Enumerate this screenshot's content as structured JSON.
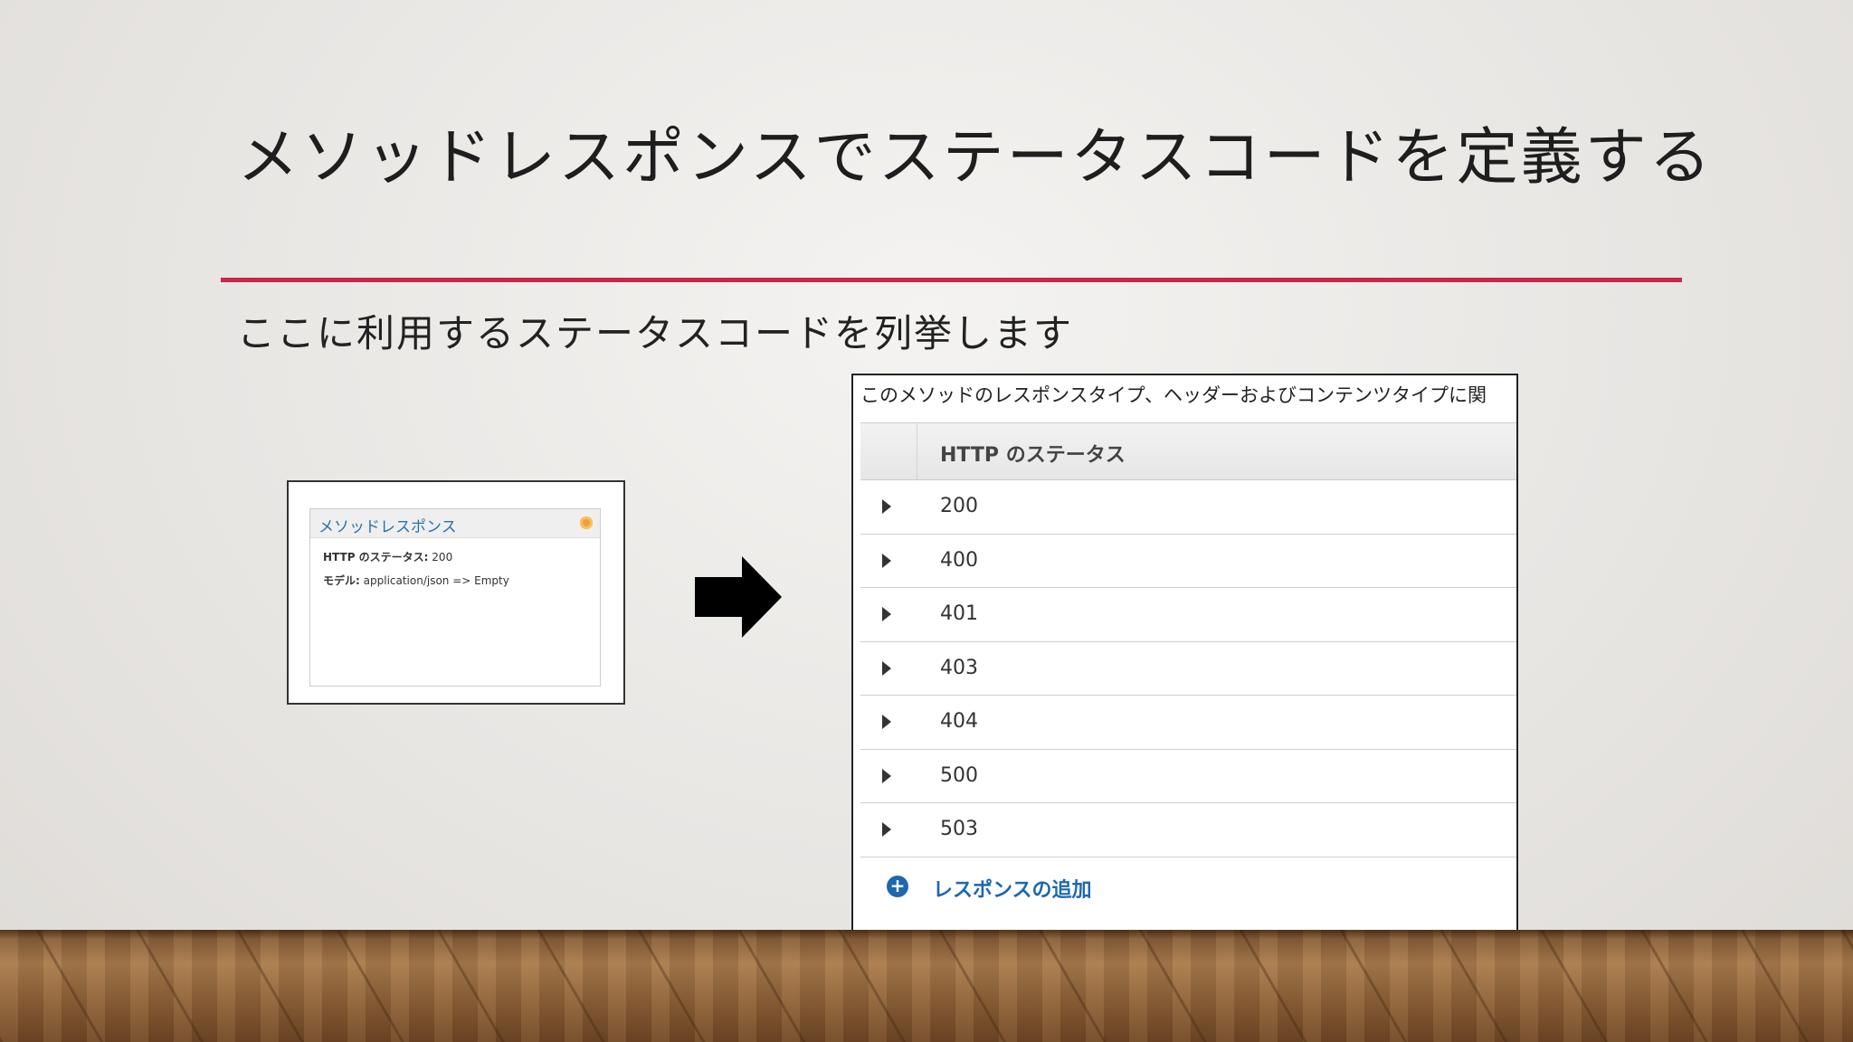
{
  "slide": {
    "title": "メソッドレスポンスでステータスコードを定義する",
    "subtitle": "ここに利用するステータスコードを列挙します",
    "accent_color": "#c8264a"
  },
  "small_panel": {
    "header": "メソッドレスポンス",
    "status_label": "HTTP のステータス:",
    "status_value": "200",
    "model_label": "モデル:",
    "model_value": "application/json => Empty"
  },
  "arrow_icon": "right-arrow-icon",
  "big_panel": {
    "description": "このメソッドのレスポンスタイプ、ヘッダーおよびコンテンツタイプに関",
    "column_header": "HTTP のステータス",
    "rows": [
      "200",
      "400",
      "401",
      "403",
      "404",
      "500",
      "503"
    ],
    "add_icon": "plus-circle-icon",
    "add_label": "レスポンスの追加",
    "link_color": "#1d67b0"
  }
}
